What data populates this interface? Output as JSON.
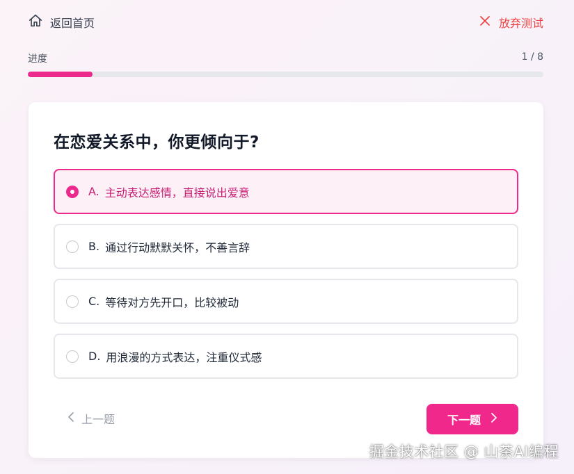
{
  "header": {
    "home_label": "返回首页",
    "quit_label": "放弃测试"
  },
  "progress": {
    "label": "进度",
    "count_text": "1 / 8",
    "current": 1,
    "total": 8
  },
  "question": {
    "title": "在恋爱关系中，你更倾向于?",
    "selected_index": 0,
    "options": [
      {
        "key": "A.",
        "text": "主动表达感情，直接说出爱意"
      },
      {
        "key": "B.",
        "text": "通过行动默默关怀，不善言辞"
      },
      {
        "key": "C.",
        "text": "等待对方先开口，比较被动"
      },
      {
        "key": "D.",
        "text": "用浪漫的方式表达，注重仪式感"
      }
    ]
  },
  "nav": {
    "prev_label": "上一题",
    "next_label": "下一题"
  },
  "watermark": "掘金技术社区 @ 山茶AI编程",
  "colors": {
    "accent": "#ec2a8c",
    "danger": "#ef4444"
  },
  "icons": {
    "home": "home-icon",
    "quit": "close-icon",
    "prev": "chevron-left-icon",
    "next": "chevron-right-icon"
  }
}
